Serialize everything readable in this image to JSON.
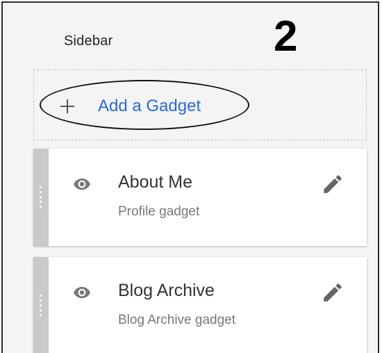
{
  "panel": {
    "title": "Sidebar",
    "step_number": "2"
  },
  "add_gadget": {
    "label": "Add a Gadget",
    "icon": "plus-icon"
  },
  "gadgets": [
    {
      "name": "About Me",
      "description": "Profile gadget",
      "visibility_icon": "eye-icon",
      "edit_icon": "pencil-icon"
    },
    {
      "name": "Blog Archive",
      "description": "Blog Archive gadget",
      "visibility_icon": "eye-icon",
      "edit_icon": "pencil-icon"
    }
  ],
  "colors": {
    "link": "#2a6ad8",
    "handle": "#c9c9c9"
  }
}
